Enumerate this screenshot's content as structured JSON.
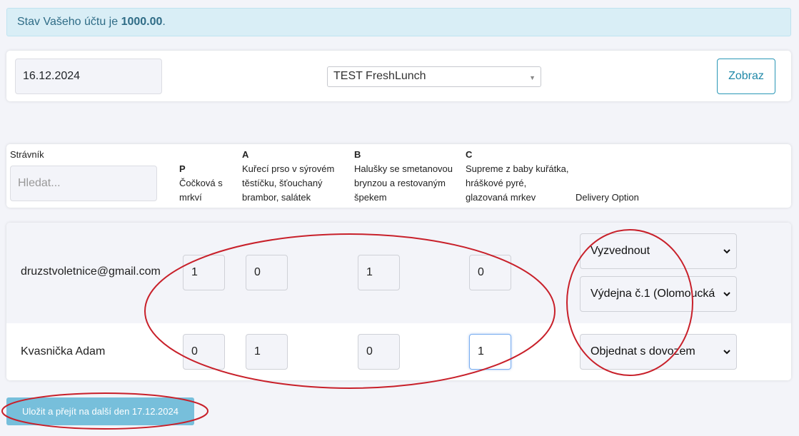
{
  "alert": {
    "prefix": "Stav Vašeho účtu je ",
    "balance": "1000.00",
    "suffix": "."
  },
  "filter": {
    "date": "16.12.2024",
    "restaurant": "TEST FreshLunch",
    "show_button": "Zobraz"
  },
  "header": {
    "diner_label": "Strávník",
    "search_placeholder": "Hledat...",
    "meals": [
      {
        "code": "P",
        "name": "Čočková s mrkví"
      },
      {
        "code": "A",
        "name": "Kuřecí prso v sýrovém těstíčku, šťouchaný brambor, salátek"
      },
      {
        "code": "B",
        "name": "Halušky se smetanovou brynzou a restovaným špekem"
      },
      {
        "code": "C",
        "name": "Supreme z baby kuřátka, hráškové pyré, glazovaná mrkev"
      }
    ],
    "delivery_label": "Delivery Option"
  },
  "rows": [
    {
      "name": "druzstvoletnice@gmail.com",
      "quantities": [
        "1",
        "0",
        "1",
        "0"
      ],
      "delivery": "Vyzvednout",
      "pickup_point": "Výdejna č.1 (Olomoucká"
    },
    {
      "name": "Kvasnička Adam",
      "quantities": [
        "0",
        "1",
        "0",
        "1"
      ],
      "delivery": "Objednat s dovozem"
    }
  ],
  "save_button": "Uložit a přejít na další den 17.12.2024",
  "colors": {
    "accent": "#1f88a8",
    "annotation": "#c8202a"
  }
}
